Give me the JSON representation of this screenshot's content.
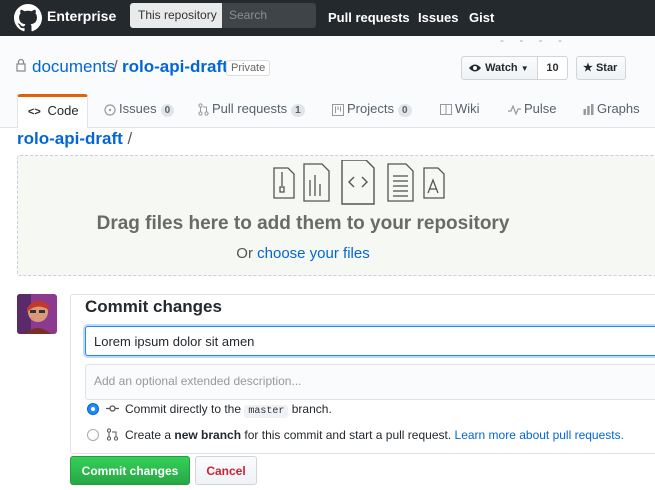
{
  "colors": {
    "topbar": "#24292e",
    "link": "#0366d6",
    "accent": "#e36209",
    "primary_button": "#28a745",
    "danger_text": "#cb2431"
  },
  "topbar": {
    "brand": "Enterprise",
    "scope_label": "This repository",
    "search_placeholder": "Search",
    "nav": [
      "Pull requests",
      "Issues",
      "Gist"
    ]
  },
  "repo": {
    "owner": "documents",
    "separator": "/",
    "name": "rolo-api-draft",
    "visibility": "Private",
    "watch_label": "Watch",
    "watch_count": "10",
    "star_label": "Star"
  },
  "tabs": [
    {
      "label": "Code",
      "icon": "code-icon"
    },
    {
      "label": "Issues",
      "count": "0",
      "icon": "issue-icon"
    },
    {
      "label": "Pull requests",
      "count": "1",
      "icon": "pull-request-icon"
    },
    {
      "label": "Projects",
      "count": "0",
      "icon": "project-icon"
    },
    {
      "label": "Wiki",
      "icon": "book-icon"
    },
    {
      "label": "Pulse",
      "icon": "pulse-icon"
    },
    {
      "label": "Graphs",
      "icon": "graph-icon"
    }
  ],
  "breadcrumb": {
    "repo": "rolo-api-draft",
    "slash": "/"
  },
  "dropzone": {
    "title": "Drag files here to add them to your repository",
    "prefix": "Or ",
    "link": "choose your files"
  },
  "commit": {
    "title": "Commit changes",
    "summary_value": "Lorem ipsum dolor sit amen",
    "description_placeholder": "Add an optional extended description...",
    "option_direct_prefix": "Commit directly to the",
    "branch": "master",
    "option_direct_suffix": "branch.",
    "option_new_prefix": "Create a",
    "option_new_bold": "new branch",
    "option_new_rest": "for this commit and start a pull request.",
    "option_new_link": "Learn more about pull requests.",
    "submit_label": "Commit changes",
    "cancel_label": "Cancel"
  }
}
